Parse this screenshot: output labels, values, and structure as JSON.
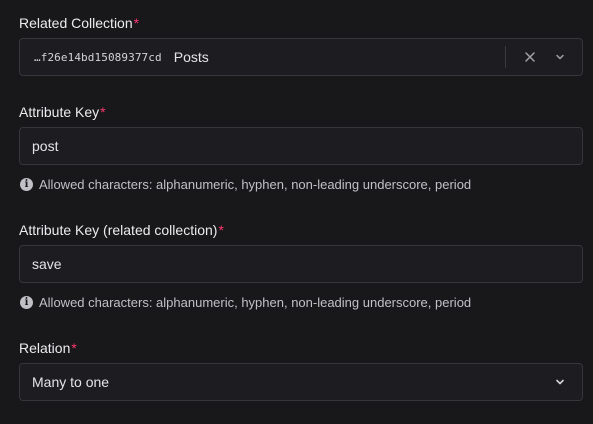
{
  "related_collection": {
    "label": "Related Collection",
    "required_mark": "*",
    "id_text": "…f26e14bd15089377cd",
    "name": "Posts",
    "clear_icon": "close-icon",
    "dropdown_icon": "chevron-down-icon"
  },
  "attribute_key": {
    "label": "Attribute Key",
    "required_mark": "*",
    "value": "post",
    "hint": "Allowed characters: alphanumeric, hyphen, non-leading underscore, period",
    "hint_icon": "info-icon"
  },
  "related_attribute_key": {
    "label": "Attribute Key (related collection)",
    "required_mark": "*",
    "value": "save",
    "hint": "Allowed characters: alphanumeric, hyphen, non-leading underscore, period",
    "hint_icon": "info-icon"
  },
  "relation": {
    "label": "Relation",
    "required_mark": "*",
    "selected": "Many to one",
    "dropdown_icon": "chevron-down-icon"
  },
  "colors": {
    "background": "#18181b",
    "field_background": "#1d1d21",
    "border": "#36363b",
    "required": "#fd366e",
    "text": "#e4e4e7",
    "hint_text": "#c0c0c6"
  }
}
